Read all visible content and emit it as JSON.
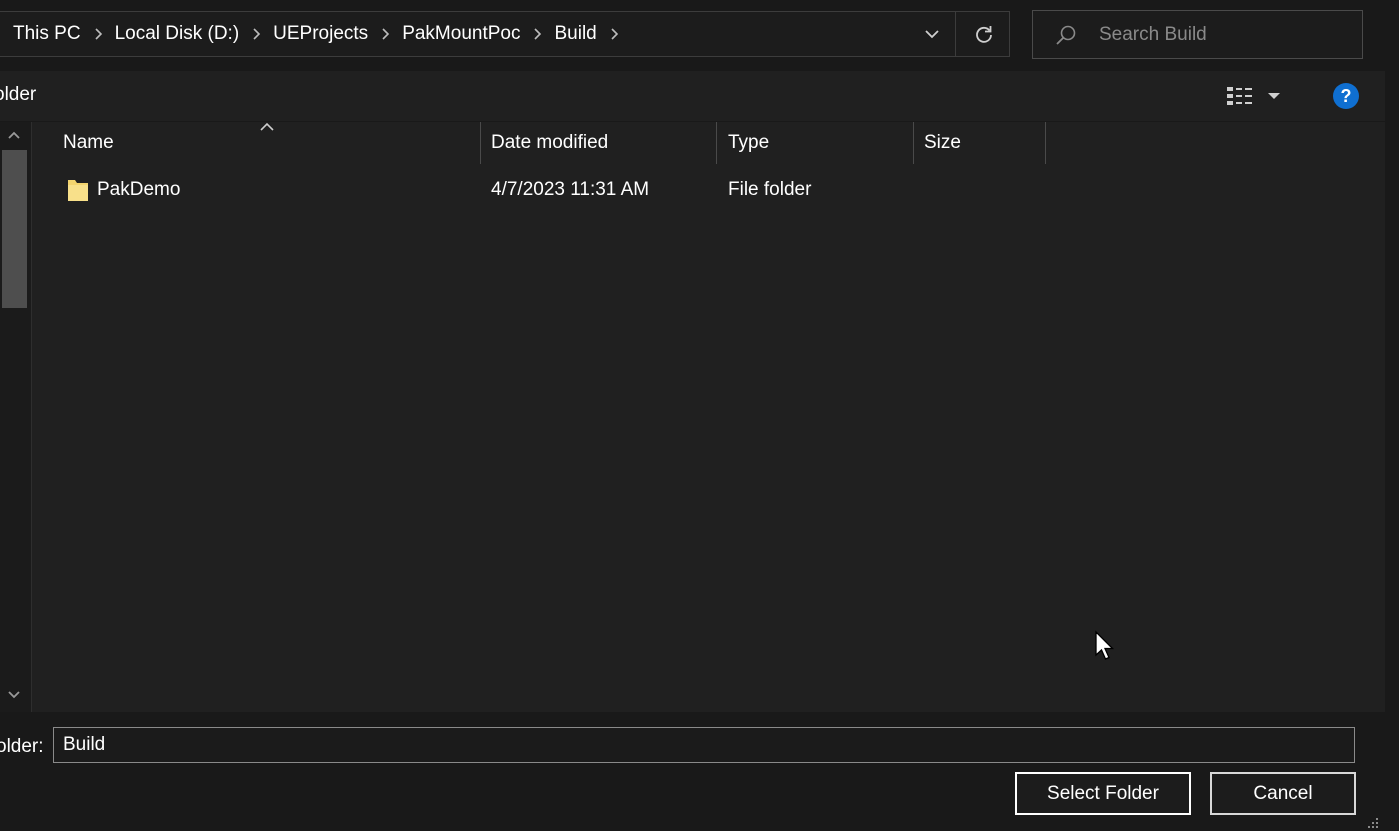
{
  "address_bar": {
    "breadcrumbs": [
      "This PC",
      "Local Disk (D:)",
      "UEProjects",
      "PakMountPoc",
      "Build"
    ]
  },
  "search": {
    "placeholder": "Search Build"
  },
  "command_bar": {
    "new_folder_label": "older"
  },
  "columns": {
    "name": "Name",
    "date_modified": "Date modified",
    "type": "Type",
    "size": "Size"
  },
  "files": [
    {
      "name": "PakDemo",
      "date_modified": "4/7/2023 11:31 AM",
      "type": "File folder",
      "size": ""
    }
  ],
  "footer": {
    "folder_label": "older:",
    "folder_value": "Build",
    "select_button": "Select Folder",
    "cancel_button": "Cancel"
  },
  "colors": {
    "accent": "#0f6fd1",
    "folder_icon": "#f3d46e",
    "background": "#202020"
  },
  "icons": [
    "chevron-right-icon",
    "chevron-down-icon",
    "refresh-icon",
    "search-icon",
    "view-options-icon",
    "help-icon",
    "folder-icon",
    "sort-up-icon",
    "resize-grip-icon",
    "mouse-cursor-icon"
  ]
}
